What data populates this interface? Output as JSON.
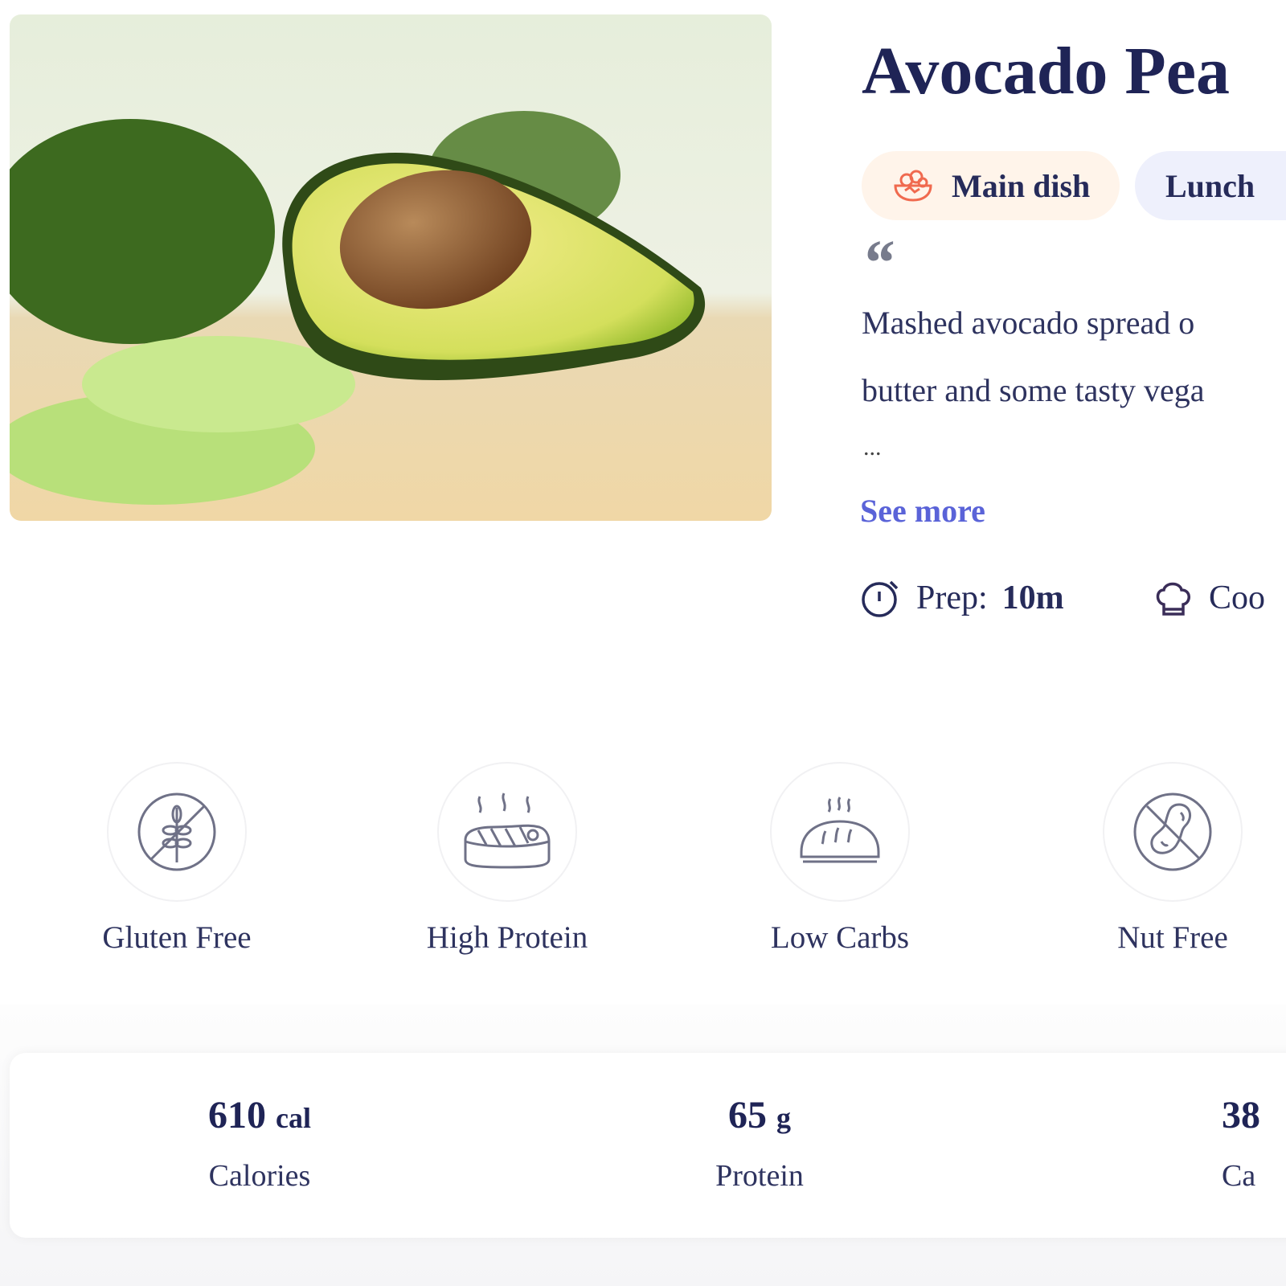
{
  "recipe": {
    "title": "Avocado Pea",
    "tags": [
      {
        "label": "Main dish",
        "icon": "salad-bowl-icon",
        "color": "#f06a4f",
        "bg": "#fff4ea"
      },
      {
        "label": "Lunch",
        "bg": "#eef0fc"
      }
    ],
    "quote_mark": "“",
    "description_lines": [
      "Mashed avocado spread o",
      "butter and some tasty vega"
    ],
    "ellipsis": "...",
    "see_more": "See more",
    "prep_label": "Prep:",
    "prep_value": "10m",
    "cook_label": "Coo",
    "accent_color": "#5a63d8"
  },
  "diet": [
    {
      "label": "Gluten Free",
      "icon": "no-gluten-icon"
    },
    {
      "label": "High Protein",
      "icon": "steak-icon"
    },
    {
      "label": "Low Carbs",
      "icon": "bread-icon"
    },
    {
      "label": "Nut Free",
      "icon": "no-nut-icon"
    }
  ],
  "nutrition": [
    {
      "value": "610",
      "unit": "cal",
      "label": "Calories"
    },
    {
      "value": "65",
      "unit": "g",
      "label": "Protein"
    },
    {
      "value": "38",
      "unit": "",
      "label": "Ca"
    }
  ]
}
